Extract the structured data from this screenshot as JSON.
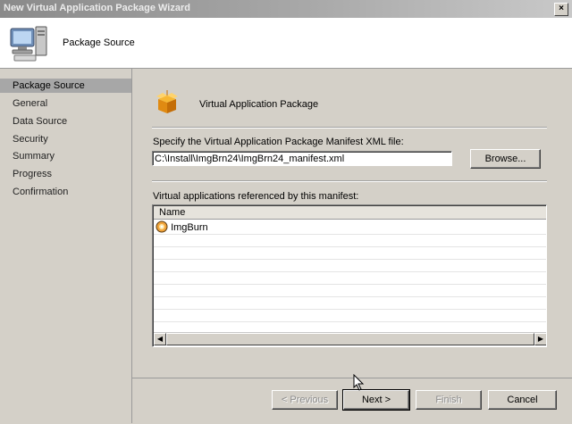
{
  "window": {
    "title": "New Virtual Application Package Wizard",
    "close_label": "×"
  },
  "header": {
    "title": "Package Source",
    "icon": "computer-icon"
  },
  "nav": {
    "items": [
      {
        "label": "Package Source",
        "selected": true
      },
      {
        "label": "General"
      },
      {
        "label": "Data Source"
      },
      {
        "label": "Security"
      },
      {
        "label": "Summary"
      },
      {
        "label": "Progress"
      },
      {
        "label": "Confirmation"
      }
    ]
  },
  "section": {
    "title": "Virtual Application Package",
    "icon": "package-icon"
  },
  "manifest": {
    "label": "Specify the Virtual Application Package Manifest XML file:",
    "value": "C:\\Install\\ImgBrn24\\ImgBrn24_manifest.xml",
    "browse_label": "Browse..."
  },
  "apps": {
    "label": "Virtual applications referenced by this manifest:",
    "column": "Name",
    "rows": [
      {
        "name": "ImgBurn",
        "icon": "imgburn-icon"
      }
    ]
  },
  "buttons": {
    "previous": "< Previous",
    "next": "Next >",
    "finish": "Finish",
    "cancel": "Cancel"
  }
}
